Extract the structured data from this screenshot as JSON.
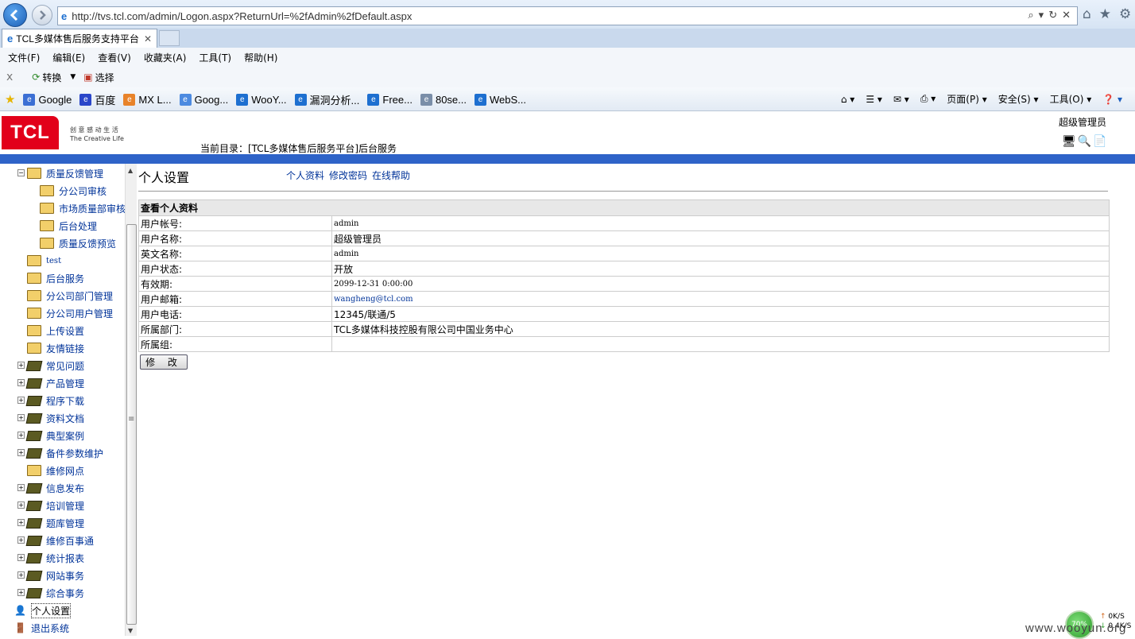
{
  "browser": {
    "url": "http://tvs.tcl.com/admin/Logon.aspx?ReturnUrl=%2fAdmin%2fDefault.aspx",
    "tab_title": "TCL多媒体售后服务支持平台",
    "menu": [
      "文件(F)",
      "编辑(E)",
      "查看(V)",
      "收藏夹(A)",
      "工具(T)",
      "帮助(H)"
    ],
    "cmd": {
      "close": "x",
      "convert": "转换",
      "select": "选择"
    },
    "favorites": [
      {
        "label": "Google",
        "icon": "google-icon",
        "color": "#3b6fd4"
      },
      {
        "label": "百度",
        "icon": "baidu-icon",
        "color": "#2a46c9"
      },
      {
        "label": "MX L...",
        "icon": "mx-icon",
        "color": "#e8832a"
      },
      {
        "label": "Goog...",
        "icon": "translate-icon",
        "color": "#4c8ae0"
      },
      {
        "label": "WooY...",
        "icon": "ie-page-icon",
        "color": "#1d6fd0"
      },
      {
        "label": "漏洞分析...",
        "icon": "ie-page-icon",
        "color": "#1d6fd0"
      },
      {
        "label": "Free...",
        "icon": "ie-page-icon",
        "color": "#1d6fd0"
      },
      {
        "label": "80se...",
        "icon": "web-slice-icon",
        "color": "#7a8ea8"
      },
      {
        "label": "WebS...",
        "icon": "ie-page-icon",
        "color": "#1d6fd0"
      }
    ],
    "commandbar": {
      "page": "页面(P)",
      "safety": "安全(S)",
      "tools": "工具(O)"
    }
  },
  "header": {
    "logo": "TCL",
    "slogan_cn": "创 意 感 动 生 活",
    "slogan_en": "The Creative Life",
    "breadcrumb": "当前目录：[TCL多媒体售后服务平台]后台服务",
    "admin": "超级管理员"
  },
  "sidebar": {
    "items": [
      {
        "label": "质量反馈管理",
        "type": "open",
        "level": 1,
        "expander": "−"
      },
      {
        "label": "分公司审核",
        "type": "open",
        "level": 2
      },
      {
        "label": "市场质量部审核",
        "type": "open",
        "level": 2
      },
      {
        "label": "后台处理",
        "type": "open",
        "level": 2
      },
      {
        "label": "质量反馈预览",
        "type": "open",
        "level": 2
      },
      {
        "label": "test",
        "type": "open",
        "level": 1
      },
      {
        "label": "后台服务",
        "type": "open",
        "level": 1
      },
      {
        "label": "分公司部门管理",
        "type": "open",
        "level": 1
      },
      {
        "label": "分公司用户管理",
        "type": "open",
        "level": 1
      },
      {
        "label": "上传设置",
        "type": "open",
        "level": 1
      },
      {
        "label": "友情链接",
        "type": "open",
        "level": 1
      },
      {
        "label": "常见问题",
        "type": "closed",
        "level": 1,
        "expander": "+"
      },
      {
        "label": "产品管理",
        "type": "closed",
        "level": 1,
        "expander": "+"
      },
      {
        "label": "程序下载",
        "type": "closed",
        "level": 1,
        "expander": "+"
      },
      {
        "label": "资料文档",
        "type": "closed",
        "level": 1,
        "expander": "+"
      },
      {
        "label": "典型案例",
        "type": "closed",
        "level": 1,
        "expander": "+"
      },
      {
        "label": "备件参数维护",
        "type": "closed",
        "level": 1,
        "expander": "+"
      },
      {
        "label": "维修网点",
        "type": "open",
        "level": 1
      },
      {
        "label": "信息发布",
        "type": "closed",
        "level": 1,
        "expander": "+"
      },
      {
        "label": "培训管理",
        "type": "closed",
        "level": 1,
        "expander": "+"
      },
      {
        "label": "题库管理",
        "type": "closed",
        "level": 1,
        "expander": "+"
      },
      {
        "label": "维修百事通",
        "type": "closed",
        "level": 1,
        "expander": "+"
      },
      {
        "label": "统计报表",
        "type": "closed",
        "level": 1,
        "expander": "+"
      },
      {
        "label": "网站事务",
        "type": "closed",
        "level": 1,
        "expander": "+"
      },
      {
        "label": "综合事务",
        "type": "closed",
        "level": 1,
        "expander": "+"
      },
      {
        "label": "个人设置",
        "type": "user",
        "level": 0
      },
      {
        "label": "退出系统",
        "type": "exit",
        "level": 0
      }
    ]
  },
  "main": {
    "title": "个人设置",
    "links": [
      "个人资料",
      "修改密码",
      "在线帮助"
    ],
    "table_header": "查看个人资料",
    "rows": [
      {
        "label": "用户帐号:",
        "value": "admin"
      },
      {
        "label": "用户名称:",
        "value": "超级管理员"
      },
      {
        "label": "英文名称:",
        "value": "admin"
      },
      {
        "label": "用户状态:",
        "value": "开放"
      },
      {
        "label": "有效期:",
        "value": "2099-12-31 0:00:00"
      },
      {
        "label": "用户邮箱:",
        "value": "wangheng@tcl.com"
      },
      {
        "label": "用户电话:",
        "value": "12345/联通/5"
      },
      {
        "label": "所属部门:",
        "value": "TCL多媒体科技控股有限公司中国业务中心"
      },
      {
        "label": "所属组:",
        "value": ""
      }
    ],
    "edit_button": "修 改"
  },
  "widget": {
    "percent": "70%",
    "upload": "0K/S",
    "download": "0.4K/S"
  },
  "watermark": "www.wooyun.org"
}
